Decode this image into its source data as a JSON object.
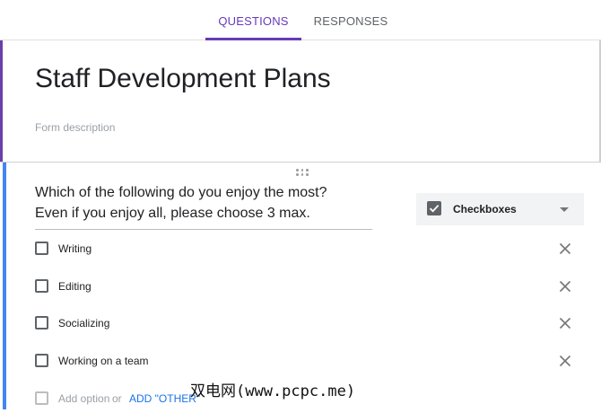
{
  "tabs": {
    "questions": "QUESTIONS",
    "responses": "RESPONSES"
  },
  "form": {
    "title": "Staff Development Plans",
    "description_placeholder": "Form description"
  },
  "question": {
    "text": "Which of the following do you enjoy the most?\nEven if you enjoy all, please choose 3 max.",
    "type_label": "Checkboxes",
    "options": [
      "Writing",
      "Editing",
      "Socializing",
      "Working on a team"
    ],
    "add_option": "Add option",
    "or": "or",
    "add_other": "ADD \"OTHER\""
  },
  "colors": {
    "accent": "#673ab7",
    "question_accent": "#4285f4",
    "link": "#1a73e8"
  },
  "watermark": "双电网(www.pcpc.me)"
}
